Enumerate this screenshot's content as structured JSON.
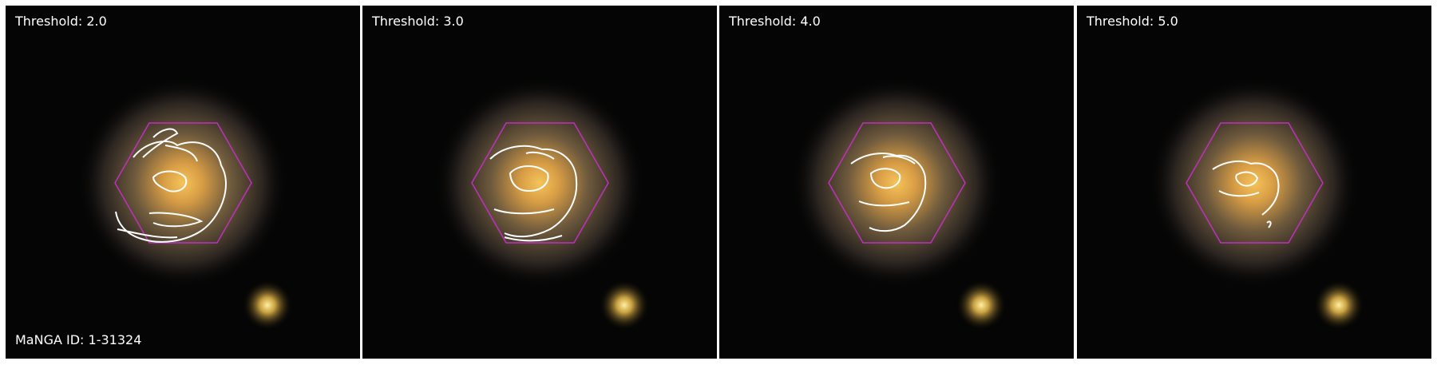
{
  "figure": {
    "panels": [
      {
        "threshold_label": "Threshold: 2.0"
      },
      {
        "threshold_label": "Threshold: 3.0"
      },
      {
        "threshold_label": "Threshold: 4.0"
      },
      {
        "threshold_label": "Threshold: 5.0"
      }
    ],
    "manga_id_label": "MaNGA ID: 1-31324"
  },
  "colors": {
    "background": "#000000",
    "galaxy_core": "#f2b94a",
    "contour": "#ffffff",
    "hexagon": "#c030c0",
    "separator": "#ffffff"
  }
}
